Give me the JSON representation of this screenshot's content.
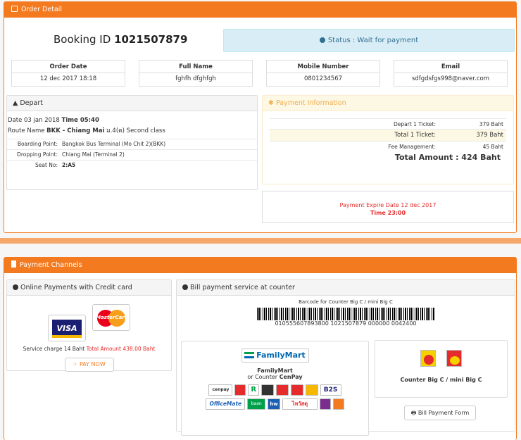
{
  "order": {
    "title": "Order Detail",
    "booking_label": "Booking ID",
    "booking_id": "1021507879",
    "status": "Status : Wait for payment",
    "fields": [
      {
        "label": "Order Date",
        "value": "12 dec 2017 18:18"
      },
      {
        "label": "Full Name",
        "value": "fghfh dfghfgh"
      },
      {
        "label": "Mobile Number",
        "value": "0801234567"
      },
      {
        "label": "Email",
        "value": "sdfgdsfgs998@naver.com"
      }
    ]
  },
  "depart": {
    "title": "Depart",
    "date_label": "Date 03 jan 2018",
    "time_label": "Time 05:40",
    "route_prefix": "Route Name",
    "route": "BKK - Chiang Mai",
    "route_suffix": "ม.4(ต) Second class",
    "rows": [
      {
        "k": "Boarding Point",
        "v": "Bangkok Bus Terminal (Mo Chit 2)(BKK)"
      },
      {
        "k": "Dropping Point",
        "v": "Chiang Mai (Terminal 2)"
      },
      {
        "k": "Seat No",
        "v": "2:A5"
      }
    ]
  },
  "payment_info": {
    "title": "Payment Information",
    "rows": [
      {
        "k": "Depart 1 Ticket",
        "v": "379 Baht"
      },
      {
        "k": "Total 1 Ticket",
        "v": "379 Baht"
      },
      {
        "k": "Fee Management",
        "v": "45 Baht"
      }
    ],
    "total": "Total Amount : 424 Baht",
    "expire_date": "Payment Expire Date 12 dec 2017",
    "expire_time": "Time 23:00"
  },
  "channels": {
    "title": "Payment Channels",
    "online": {
      "title": "Online Payments with Credit card",
      "visa": "VISA",
      "mastercard": "MasterCard",
      "service_charge": "Service charge 14 Baht",
      "total": "Total Amount 438.00 Baht",
      "pay_now": "PAY NOW"
    },
    "bill": {
      "title": "Bill payment service at counter",
      "barcode_label": "Barcode for Counter Big C / mini Big C",
      "barcode_number": "010555607893800 1021507879 000000 0042400",
      "familymart_logo": "FamilyMart",
      "familymart_name": "FamilyMart",
      "familymart_or": "or Counter",
      "cenpay": "CenPay",
      "bigc_title": "Counter Big C / mini Big C",
      "bill_form": "Bill Payment Form",
      "partner_logos": [
        "cenpay",
        "bigc",
        "robinson",
        "tops",
        "tops",
        "tops",
        "tops",
        "B2S",
        "OfficeMate",
        "baan",
        "hw",
        "ไทวัสดุ",
        "logo",
        "logo"
      ]
    }
  },
  "colors": {
    "accent": "#f47a20",
    "danger": "#e52b2b",
    "info_bg": "#d9edf7",
    "warning": "#f0ad4e"
  }
}
